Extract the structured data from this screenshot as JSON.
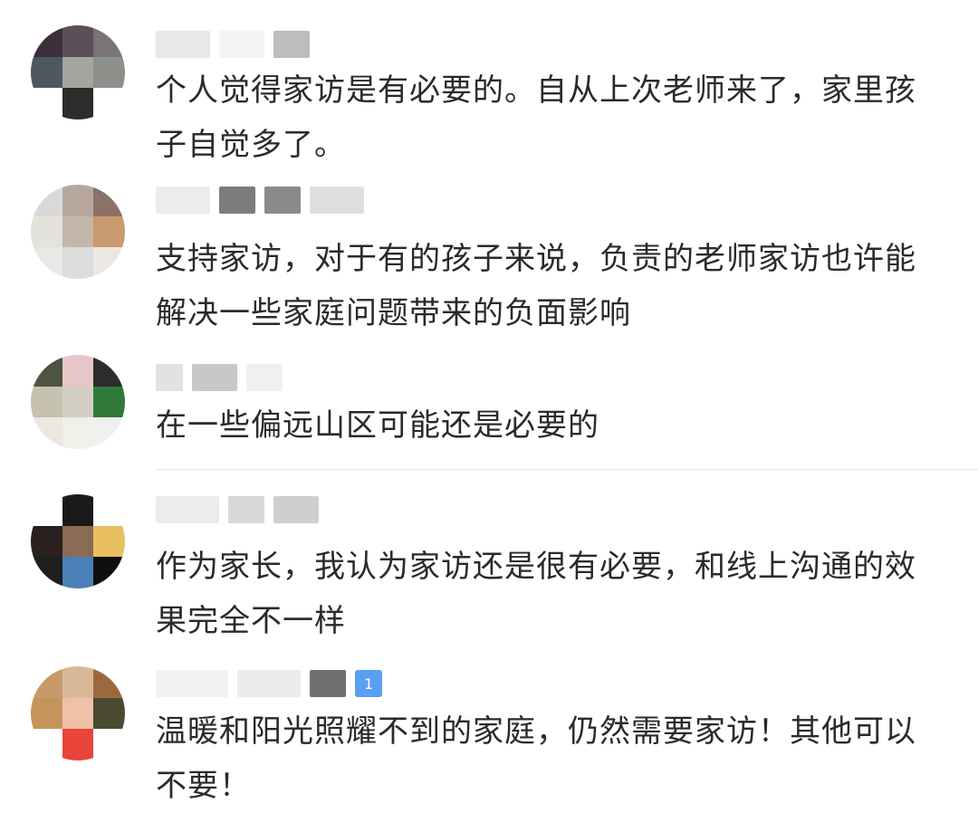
{
  "comments": [
    {
      "text": "个人觉得家访是有必要的。自从上次老师来了，家里孩子自觉多了。",
      "avatar_colors": [
        "#3a2f3a",
        "#5b5058",
        "#7a7478",
        "#4e5860",
        "#a3a59e",
        "#8c8f8a",
        "#ffffff",
        "#2e2b2c",
        "#ffffff"
      ],
      "name_colors": [
        "#e8e8e8",
        "#f4f4f4",
        "#bdbdbd"
      ]
    },
    {
      "text": "支持家访，对于有的孩子来说，负责的老师家访也许能解决一些家庭问题带来的负面影响",
      "avatar_colors": [
        "#d9d9d9",
        "#b8a79d",
        "#8a7266",
        "#e4e2dc",
        "#c4b6a8",
        "#c99a6e",
        "#e8e8e6",
        "#dcdcdc",
        "#ece7e0"
      ],
      "name_colors": [
        "#ededed",
        "#7c7c7c",
        "#8a8a8a",
        "#dedede"
      ]
    },
    {
      "text": "在一些偏远山区可能还是必要的",
      "avatar_colors": [
        "#4d5443",
        "#e7c6c8",
        "#2c2c2c",
        "#c7c1b0",
        "#d2cfc4",
        "#2f7a39",
        "#ebe8e0",
        "#f0efe8",
        "#efefef"
      ],
      "name_colors": [
        "#e2e2e2",
        "#c8c8c8",
        "#f0f0f0"
      ]
    },
    {
      "text": "作为家长，我认为家访还是很有必要，和线上沟通的效果完全不一样",
      "avatar_colors": [
        "#ffffff",
        "#1a1a1a",
        "#ffffff",
        "#2a2020",
        "#8a6a52",
        "#e8c060",
        "#1e1e1e",
        "#4a7fb8",
        "#0e0e0e"
      ],
      "name_colors": [
        "#ececec",
        "#d8d8d8",
        "#cfcfcf"
      ]
    },
    {
      "text": "温暖和阳光照耀不到的家庭，仍然需要家访！其他可以不要！",
      "avatar_colors": [
        "#c89a6a",
        "#d8b896",
        "#9a6a3e",
        "#c4945a",
        "#f0c0a8",
        "#4a4a32",
        "#ffffff",
        "#e8443a",
        "#ffffff"
      ],
      "name_colors": [
        "#f2f2f2",
        "#ebebeb",
        "#707070"
      ],
      "badge": "1"
    }
  ]
}
